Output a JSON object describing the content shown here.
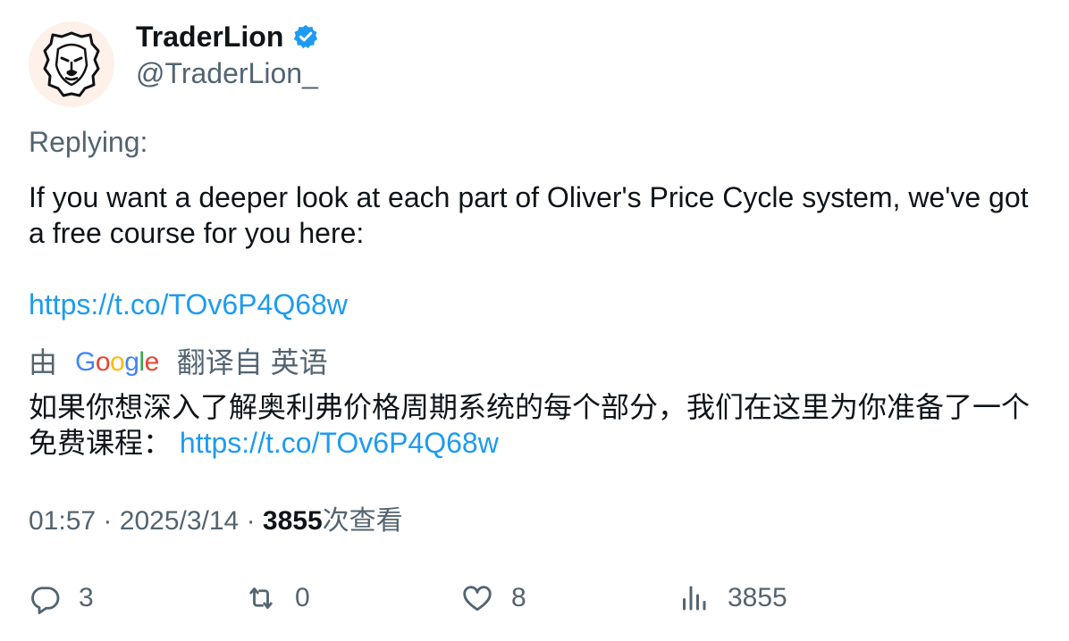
{
  "author": {
    "display_name": "TraderLion",
    "handle": "@TraderLion_",
    "avatar_icon": "lion-face-icon",
    "verified_icon": "verified-badge-icon",
    "verified_color": "#1d9bf0"
  },
  "reply": {
    "label": "Replying:"
  },
  "tweet": {
    "text": "If you want a deeper look at each part of Oliver's Price Cycle system, we've got a free course for you here:",
    "link": "https://t.co/TOv6P4Q68w"
  },
  "translation": {
    "prefix": "由",
    "provider": "Google",
    "suffix": "翻译自 英语",
    "text": "如果你想深入了解奥利弗价格周期系统的每个部分，我们在这里为你准备了一个免费课程：",
    "link": "https://t.co/TOv6P4Q68w"
  },
  "meta": {
    "time": "01:57",
    "separator": "·",
    "date": "2025/3/14",
    "views": "3855",
    "views_label": "次查看"
  },
  "actions": {
    "reply": {
      "icon": "reply-icon",
      "count": "3"
    },
    "retweet": {
      "icon": "retweet-icon",
      "count": "0"
    },
    "like": {
      "icon": "heart-icon",
      "count": "8"
    },
    "views": {
      "icon": "analytics-icon",
      "count": "3855"
    }
  },
  "colors": {
    "link": "#1d9bf0",
    "secondary_text": "#536471",
    "primary_text": "#0f1419"
  }
}
